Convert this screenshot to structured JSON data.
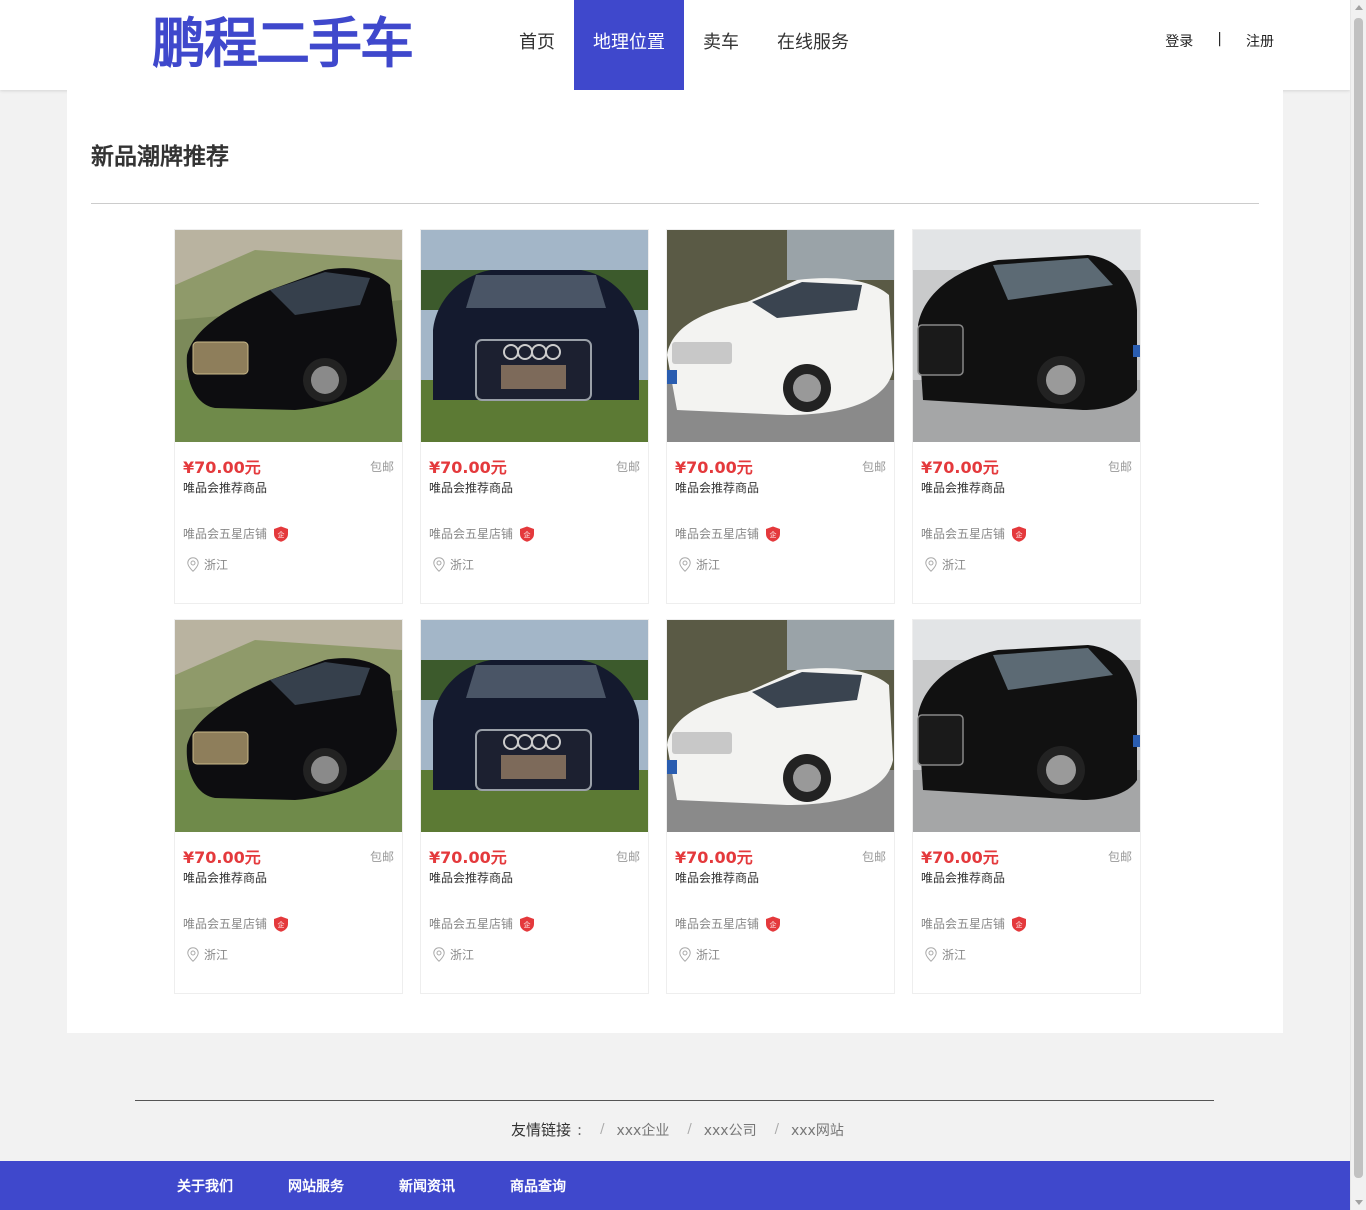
{
  "brand": {
    "logo_text": "鹏程二手车",
    "accent": "#3f48cc"
  },
  "nav": {
    "items": [
      {
        "label": "首页",
        "active": false
      },
      {
        "label": "地理位置",
        "active": true
      },
      {
        "label": "卖车",
        "active": false
      },
      {
        "label": "在线服务",
        "active": false
      }
    ]
  },
  "auth": {
    "login": "登录",
    "separator": "|",
    "register": "注册"
  },
  "section": {
    "title": "新品潮牌推荐"
  },
  "products": [
    {
      "car": "black-sedan",
      "price": "¥70.00元",
      "shipping": "包邮",
      "title": "唯品会推荐商品",
      "shop": "唯品会五星店铺",
      "badge": "企",
      "location": "浙江"
    },
    {
      "car": "navy-suv",
      "price": "¥70.00元",
      "shipping": "包邮",
      "title": "唯品会推荐商品",
      "shop": "唯品会五星店铺",
      "badge": "企",
      "location": "浙江"
    },
    {
      "car": "white-sedan",
      "price": "¥70.00元",
      "shipping": "包邮",
      "title": "唯品会推荐商品",
      "shop": "唯品会五星店铺",
      "badge": "企",
      "location": "浙江"
    },
    {
      "car": "black-suv",
      "price": "¥70.00元",
      "shipping": "包邮",
      "title": "唯品会推荐商品",
      "shop": "唯品会五星店铺",
      "badge": "企",
      "location": "浙江"
    },
    {
      "car": "black-sedan",
      "price": "¥70.00元",
      "shipping": "包邮",
      "title": "唯品会推荐商品",
      "shop": "唯品会五星店铺",
      "badge": "企",
      "location": "浙江"
    },
    {
      "car": "navy-suv",
      "price": "¥70.00元",
      "shipping": "包邮",
      "title": "唯品会推荐商品",
      "shop": "唯品会五星店铺",
      "badge": "企",
      "location": "浙江"
    },
    {
      "car": "white-sedan",
      "price": "¥70.00元",
      "shipping": "包邮",
      "title": "唯品会推荐商品",
      "shop": "唯品会五星店铺",
      "badge": "企",
      "location": "浙江"
    },
    {
      "car": "black-suv",
      "price": "¥70.00元",
      "shipping": "包邮",
      "title": "唯品会推荐商品",
      "shop": "唯品会五星店铺",
      "badge": "企",
      "location": "浙江"
    }
  ],
  "friends": {
    "label": "友情链接",
    "colon": ":",
    "separator": "/",
    "links": [
      "xxx企业",
      "xxx公司",
      "xxx网站"
    ]
  },
  "footer": {
    "links": [
      "关于我们",
      "网站服务",
      "新闻资讯",
      "商品查询"
    ]
  },
  "colors": {
    "price": "#e4393c",
    "badge": "#e4393c",
    "footer_bg": "#3f48cc"
  }
}
